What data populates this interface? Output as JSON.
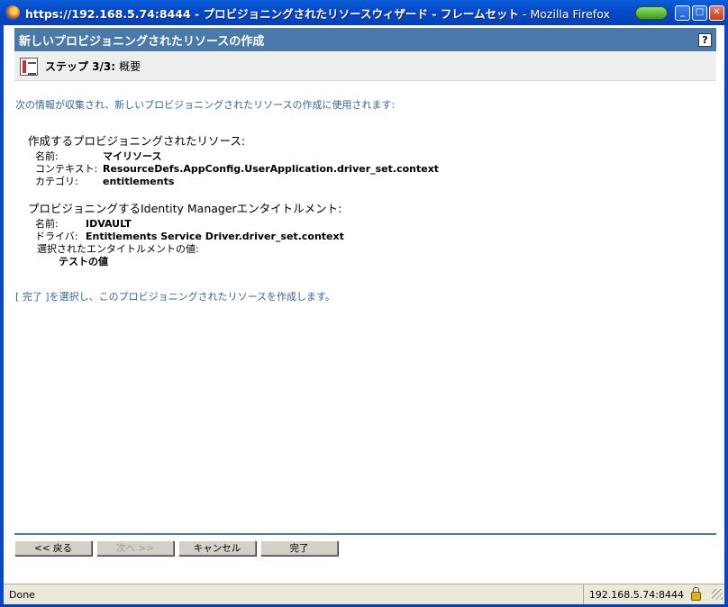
{
  "window": {
    "title_url": "https://192.168.5.74:8444",
    "title_sep": " - ",
    "title_page": "プロビジョニングされたリソースウィザード - フレームセット",
    "title_app": " - Mozilla Firefox",
    "minimize_glyph": "_",
    "maximize_glyph": "□",
    "close_glyph": "✕"
  },
  "header": {
    "title": "新しいプロビジョニングされたリソースの作成",
    "help_glyph": "?"
  },
  "step": {
    "label": "ステップ 3/3:",
    "name": "概要"
  },
  "intro_text": "次の情報が収集され、新しいプロビジョニングされたリソースの作成に使用されます:",
  "resource_section": {
    "title": "作成するプロビジョニングされたリソース:",
    "rows": [
      {
        "label": "名前:",
        "value": "マイリソース"
      },
      {
        "label": "コンテキスト:",
        "value": "ResourceDefs.AppConfig.UserApplication.driver_set.context"
      },
      {
        "label": "カテゴリ:",
        "value": "entitlements"
      }
    ]
  },
  "entitlement_section": {
    "title": "プロビジョニングするIdentity Managerエンタイトルメント:",
    "rows": [
      {
        "label": "名前:",
        "value": "IDVAULT"
      },
      {
        "label": "ドライバ:",
        "value": "Entitlements Service Driver.driver_set.context"
      }
    ],
    "selected_label": "選択されたエンタイトルメントの値:",
    "selected_value": "テストの値"
  },
  "finish_note": "[ 完了 ]を選択し、このプロビジョニングされたリソースを作成します。",
  "buttons": {
    "back": "<< 戻る",
    "next": "次へ >>",
    "cancel": "キャンセル",
    "finish": "完了"
  },
  "statusbar": {
    "status": "Done",
    "host": "192.168.5.74:8444"
  }
}
